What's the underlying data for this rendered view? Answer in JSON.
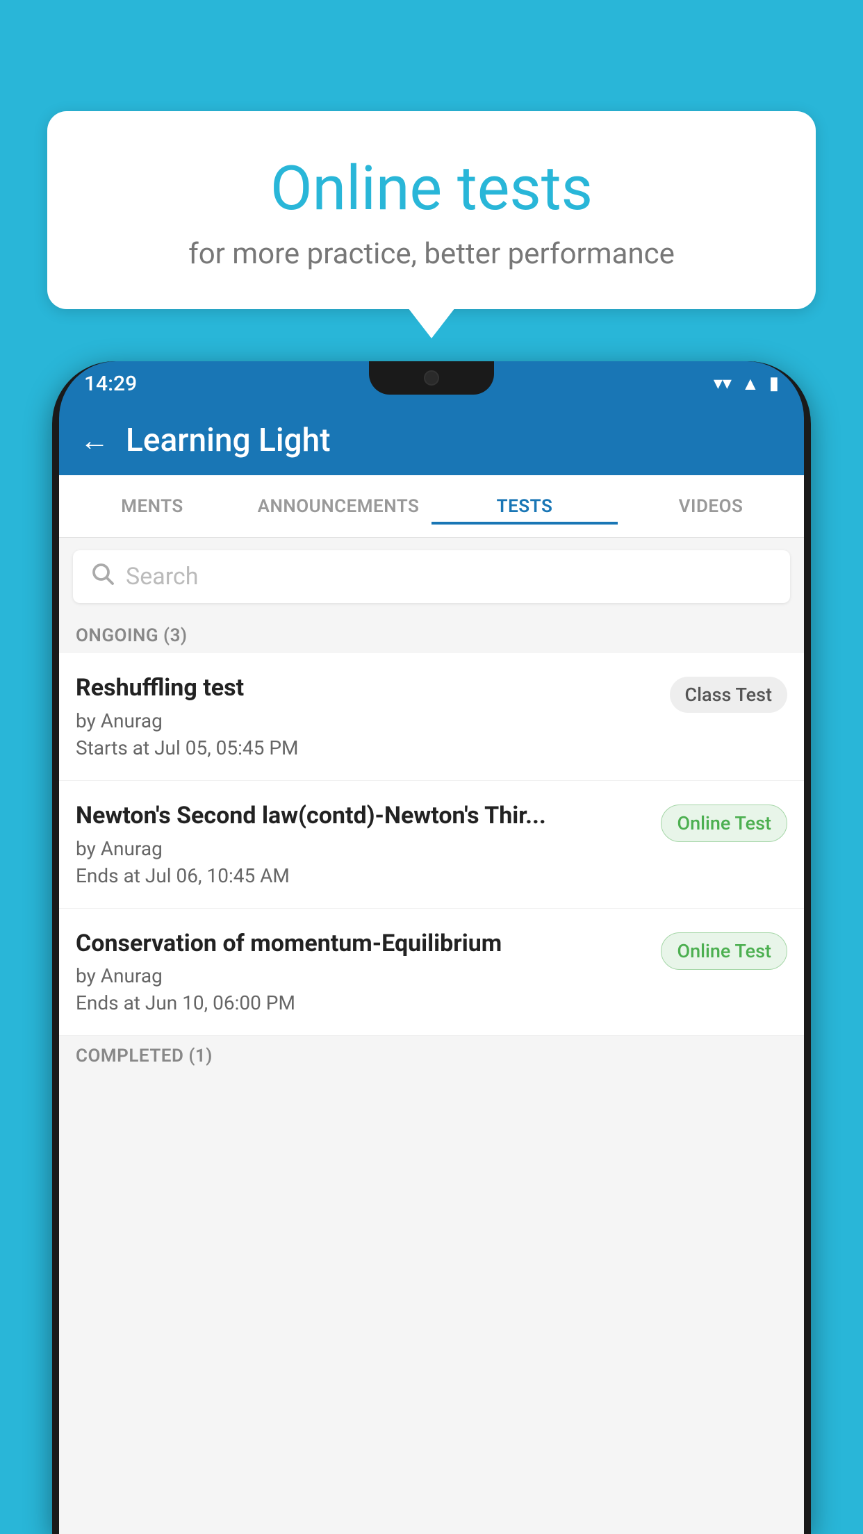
{
  "background": {
    "color": "#29b6d8"
  },
  "bubble": {
    "title": "Online tests",
    "subtitle": "for more practice, better performance"
  },
  "status_bar": {
    "time": "14:29",
    "wifi": "▼",
    "signal": "▲",
    "battery": "▮"
  },
  "app_header": {
    "back_label": "←",
    "title": "Learning Light"
  },
  "tabs": [
    {
      "label": "MENTS",
      "active": false
    },
    {
      "label": "ANNOUNCEMENTS",
      "active": false
    },
    {
      "label": "TESTS",
      "active": true
    },
    {
      "label": "VIDEOS",
      "active": false
    }
  ],
  "search": {
    "placeholder": "Search"
  },
  "section_ongoing": {
    "label": "ONGOING (3)"
  },
  "tests": [
    {
      "name": "Reshuffling test",
      "author": "by Anurag",
      "time": "Starts at  Jul 05, 05:45 PM",
      "badge": "Class Test",
      "badge_type": "class"
    },
    {
      "name": "Newton's Second law(contd)-Newton's Thir...",
      "author": "by Anurag",
      "time": "Ends at  Jul 06, 10:45 AM",
      "badge": "Online Test",
      "badge_type": "online"
    },
    {
      "name": "Conservation of momentum-Equilibrium",
      "author": "by Anurag",
      "time": "Ends at  Jun 10, 06:00 PM",
      "badge": "Online Test",
      "badge_type": "online"
    }
  ],
  "section_completed": {
    "label": "COMPLETED (1)"
  }
}
